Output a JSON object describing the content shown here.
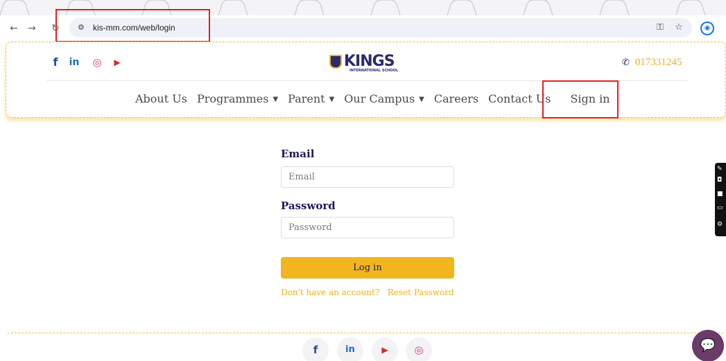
{
  "browser": {
    "url": "kis-mm.com/web/login",
    "back_icon": "←",
    "forward_icon": "→",
    "reload_icon": "↻",
    "tune_icon": "⚙",
    "key_icon": "⚿",
    "star_icon": "☆",
    "profile_icon": "◉"
  },
  "header": {
    "social": {
      "facebook": "f",
      "linkedin": "in",
      "instagram": "◎",
      "youtube": "▶"
    },
    "logo_text": "KINGS",
    "logo_subtext": "INTERNATIONAL SCHOOL",
    "phone_icon": "✆",
    "phone": "017331245"
  },
  "menu": {
    "items": [
      {
        "label": "About Us",
        "caret": ""
      },
      {
        "label": "Programmes",
        "caret": "▼"
      },
      {
        "label": "Parent",
        "caret": "▼"
      },
      {
        "label": "Our Campus",
        "caret": "▼"
      },
      {
        "label": "Careers",
        "caret": ""
      },
      {
        "label": "Contact Us",
        "caret": ""
      },
      {
        "label": "Sign in",
        "caret": ""
      }
    ]
  },
  "form": {
    "email_label": "Email",
    "email_placeholder": "Email",
    "password_label": "Password",
    "password_placeholder": "Password",
    "login_label": "Log in",
    "signup_link": "Don't have an account?",
    "reset_link": "Reset Password"
  },
  "footer": {
    "facebook": "f",
    "linkedin": "in",
    "youtube": "▶",
    "instagram": "◎"
  },
  "chat_icon": "💬",
  "colors": {
    "brand_navy": "#1c1a5a",
    "accent_gold": "#f2b51f",
    "highlight_red": "#e02020"
  }
}
